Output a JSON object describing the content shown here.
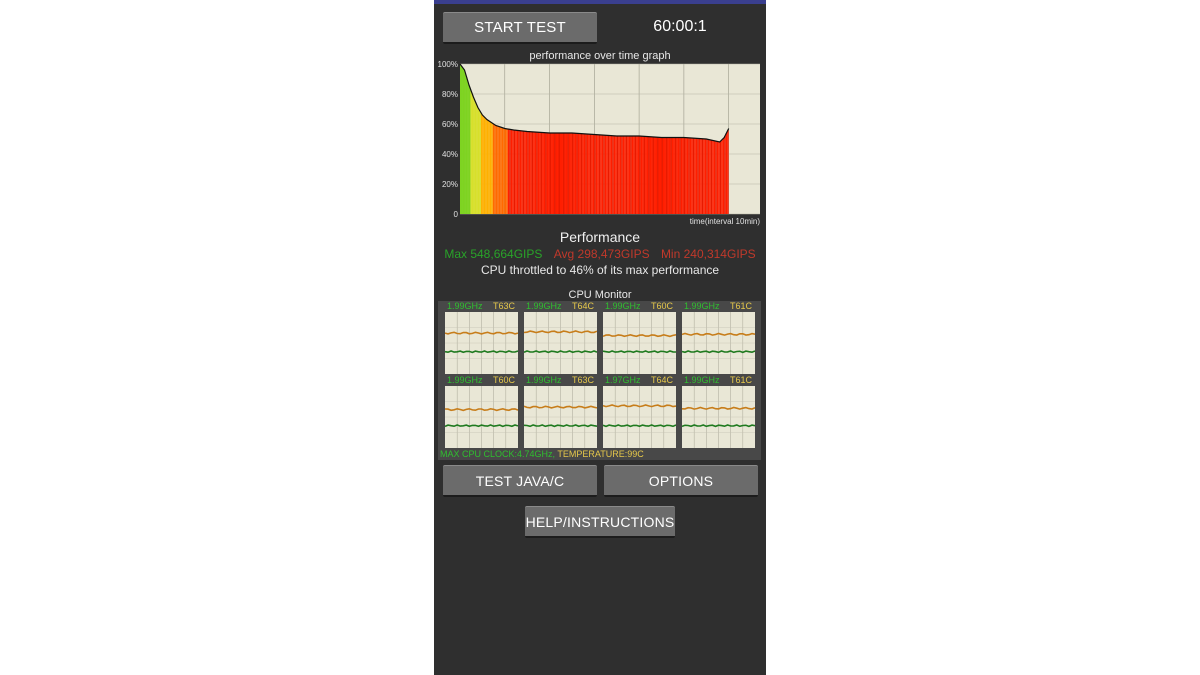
{
  "colors": {
    "accent_topbar": "#3a3f8f",
    "max": "#29a329",
    "avg_min": "#c0392b",
    "ghz": "#2fbf2f",
    "temp": "#e6c84a"
  },
  "header": {
    "start_label": "START TEST",
    "timer": "60:00:1"
  },
  "graph": {
    "title": "performance over time graph",
    "xlabel": "time(interval 10min)",
    "yticks": [
      "100%",
      "80%",
      "60%",
      "40%",
      "20%",
      "0"
    ]
  },
  "chart_data": {
    "type": "area",
    "title": "performance over time graph",
    "xlabel": "time(interval 10min)",
    "ylabel": "",
    "ylim": [
      0,
      100
    ],
    "xlim": [
      0,
      67
    ],
    "y_unit": "%",
    "x_unit": "min",
    "grid": true,
    "x": [
      0,
      1,
      2,
      3,
      4,
      5,
      6,
      8,
      10,
      12,
      15,
      20,
      25,
      30,
      35,
      40,
      45,
      50,
      55,
      58,
      59,
      60
    ],
    "values": [
      100,
      96,
      86,
      78,
      71,
      66,
      63,
      59,
      57,
      56,
      55,
      54,
      54,
      53,
      52,
      52,
      51,
      51,
      50,
      48,
      51,
      57
    ]
  },
  "performance": {
    "title": "Performance",
    "max": "Max 548,664GIPS",
    "avg": "Avg 298,473GIPS",
    "min": "Min 240,314GIPS",
    "throttle": "CPU throttled to 46% of its max performance"
  },
  "cpu_monitor": {
    "title": "CPU Monitor",
    "cores": [
      {
        "ghz": "1.99GHz",
        "temp": "T63C",
        "temp_level": 0.66,
        "freq_level": 0.36
      },
      {
        "ghz": "1.99GHz",
        "temp": "T64C",
        "temp_level": 0.68,
        "freq_level": 0.36
      },
      {
        "ghz": "1.99GHz",
        "temp": "T60C",
        "temp_level": 0.62,
        "freq_level": 0.36
      },
      {
        "ghz": "1.99GHz",
        "temp": "T61C",
        "temp_level": 0.64,
        "freq_level": 0.36
      },
      {
        "ghz": "1.99GHz",
        "temp": "T60C",
        "temp_level": 0.62,
        "freq_level": 0.36
      },
      {
        "ghz": "1.99GHz",
        "temp": "T63C",
        "temp_level": 0.66,
        "freq_level": 0.36
      },
      {
        "ghz": "1.97GHz",
        "temp": "T64C",
        "temp_level": 0.68,
        "freq_level": 0.36
      },
      {
        "ghz": "1.99GHz",
        "temp": "T61C",
        "temp_level": 0.64,
        "freq_level": 0.36
      }
    ],
    "footer_clock": "MAX CPU CLOCK:4.74GHz,",
    "footer_temp": "TEMPERATURE:99C"
  },
  "buttons": {
    "java_label": "TEST JAVA/C",
    "options_label": "OPTIONS",
    "help_label": "HELP/INSTRUCTIONS"
  }
}
